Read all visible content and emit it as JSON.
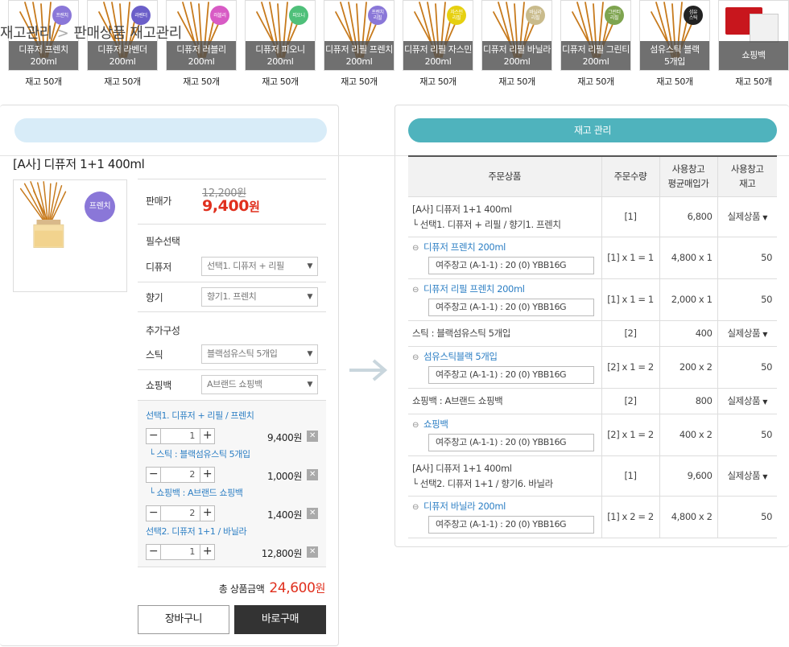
{
  "products": [
    {
      "name": "디퓨저 프렌치",
      "size": "200ml",
      "badge": "프렌치",
      "color": "#8a77d8",
      "stock": "재고 50개"
    },
    {
      "name": "디퓨저 라벤더",
      "size": "200ml",
      "badge": "라벤더",
      "color": "#6b5fc9",
      "stock": "재고 50개"
    },
    {
      "name": "디퓨저 러블리",
      "size": "200ml",
      "badge": "러블리",
      "color": "#d85bc5",
      "stock": "재고 50개"
    },
    {
      "name": "디퓨저 피오니",
      "size": "200ml",
      "badge": "피오니",
      "color": "#4fc07a",
      "stock": "재고 50개"
    },
    {
      "name": "디퓨저 리필 프렌치",
      "size": "200ml",
      "badge": "프렌치\n리필",
      "color": "#8a77d8",
      "stock": "재고 50개"
    },
    {
      "name": "디퓨저 리필 자스민",
      "size": "200ml",
      "badge": "자스민\n리필",
      "color": "#e6d010",
      "stock": "재고 50개"
    },
    {
      "name": "디퓨저 리필 바닐라",
      "size": "200ml",
      "badge": "바닐라\n리필",
      "color": "#c9bb8c",
      "stock": "재고 50개"
    },
    {
      "name": "디퓨저 리필 그린티",
      "size": "200ml",
      "badge": "그린티\n리필",
      "color": "#7ea44f",
      "stock": "재고 50개"
    },
    {
      "name": "섬유스틱 블랙",
      "size": "5개입",
      "badge": "섬유\n스틱",
      "color": "#222222",
      "stock": "재고 50개"
    },
    {
      "name": "쇼핑백",
      "size": "",
      "badge": "",
      "color": "",
      "stock": "재고 50개"
    }
  ],
  "breadcrumb": {
    "root": "재고관리",
    "sep": ">",
    "current": "판매상품 재고관리"
  },
  "product": {
    "title": "[A사] 디퓨저 1+1 400ml",
    "badge": "프렌치",
    "price_label": "판매가",
    "price_original": "12,200원",
    "price_sale": "9,400",
    "price_unit": "원",
    "required_label": "필수선택",
    "diffuser_label": "디퓨저",
    "diffuser_value": "선택1. 디퓨저 + 리필",
    "scent_label": "향기",
    "scent_value": "향기1. 프렌치",
    "extra_label": "추가구성",
    "stick_label": "스틱",
    "stick_value": "블랙섬유스틱 5개입",
    "bag_label": "쇼핑백",
    "bag_value": "A브랜드 쇼핑백"
  },
  "chosen": [
    {
      "name": "선택1. 디퓨저 + 리필 / 프렌치",
      "qty": "1",
      "price": "9,400원"
    },
    {
      "name": "└ 스틱 : 블랙섬유스틱 5개입",
      "qty": "2",
      "price": "1,000원"
    },
    {
      "name": "└ 쇼핑백 : A브랜드 쇼핑백",
      "qty": "2",
      "price": "1,400원"
    },
    {
      "name": "선택2. 디퓨저 1+1 / 바닐라",
      "qty": "1",
      "price": "12,800원"
    }
  ],
  "total": {
    "label": "총 상품금액",
    "amount": "24,600",
    "unit": "원"
  },
  "buttons": {
    "cart": "장바구니",
    "buy": "바로구매"
  },
  "inventory": {
    "title": "재고 관리",
    "headers": [
      "주문상품",
      "주문수량",
      "사용창고\n평균매입가",
      "사용창고\n재고"
    ],
    "rows": [
      {
        "type": "parent",
        "line1": "[A사] 디퓨저 1+1 400ml",
        "line2": "└ 선택1. 디퓨저 + 리필 / 향기1. 프렌치",
        "qty": "[1]",
        "price": "6,800",
        "stock": "실제상품"
      },
      {
        "type": "child",
        "link": "디퓨저 프렌치 200ml",
        "wh": "여주창고 (A-1-1) : 20 (0) YBB16G",
        "qty": "[1] x 1 = 1",
        "price": "4,800 x 1",
        "stock": "50"
      },
      {
        "type": "child",
        "link": "디퓨저 리필 프렌치 200ml",
        "wh": "여주창고 (A-1-1) : 20 (0) YBB16G",
        "qty": "[1] x 1 = 1",
        "price": "2,000 x 1",
        "stock": "50"
      },
      {
        "type": "parent",
        "line1": "스틱 : 블랙섬유스틱 5개입",
        "line2": "",
        "qty": "[2]",
        "price": "400",
        "stock": "실제상품"
      },
      {
        "type": "child",
        "link": "섬유스틱블랙 5개입",
        "wh": "여주창고 (A-1-1) : 20 (0) YBB16G",
        "qty": "[2] x 1 = 2",
        "price": "200 x 2",
        "stock": "50"
      },
      {
        "type": "parent",
        "line1": "쇼핑백 : A브랜드 쇼핑백",
        "line2": "",
        "qty": "[2]",
        "price": "800",
        "stock": "실제상품"
      },
      {
        "type": "child",
        "link": "쇼핑백",
        "wh": "여주창고 (A-1-1) : 20 (0) YBB16G",
        "qty": "[2] x 1 = 2",
        "price": "400 x 2",
        "stock": "50"
      },
      {
        "type": "parent",
        "line1": "[A사] 디퓨저 1+1 400ml",
        "line2": "└ 선택2. 디퓨저 1+1 / 향기6. 바닐라",
        "qty": "[1]",
        "price": "9,600",
        "stock": "실제상품"
      },
      {
        "type": "child",
        "link": "디퓨저 바닐라 200ml",
        "wh": "여주창고 (A-1-1) : 20 (0) YBB16G",
        "qty": "[1] x 2 = 2",
        "price": "4,800 x 2",
        "stock": "50"
      }
    ]
  },
  "colors": {
    "accent": "#4fb3bd",
    "sale": "#e0301e",
    "link": "#2d7fc4",
    "breadcrumb_bg": "#d8ecf8"
  }
}
